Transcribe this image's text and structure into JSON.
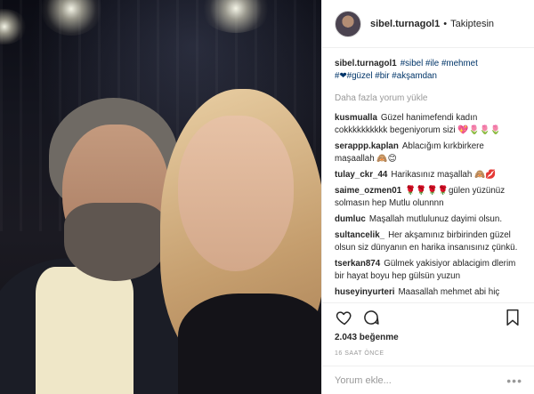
{
  "post": {
    "author": "sibel.turnagol1",
    "separator": "•",
    "follow_status": "Takiptesin",
    "caption": {
      "user": "sibel.turnagol1",
      "text_prefix": "#sibel #ile #mehmet",
      "text_line2": "#❤#güzel #bir #akşamdan"
    },
    "load_more": "Daha fazla yorum yükle",
    "comments": [
      {
        "user": "kusmualla",
        "text": "Güzel hanimefendi kadın cokkkkkkkkkk begeniyorum sizi 💖🌷🌷🌷"
      },
      {
        "user": "serappp.kaplan",
        "text": "Ablacığım kırkbirkere maşaallah 🙈😊"
      },
      {
        "user": "tulay_ckr_44",
        "text": "Harikasınız maşallah 🙈💋"
      },
      {
        "user": "saime_ozmen01",
        "text": "🌹🌹🌹🌹gülen yüzünüz solmasın hep Mutlu olunnnn"
      },
      {
        "user": "dumluc",
        "text": "Maşallah mutlulunuz dayimi olsun."
      },
      {
        "user": "sultancelik_",
        "text": "Her akşamınız birbirinden güzel olsun siz dünyanın en harika insanısınız çünkü."
      },
      {
        "user": "tserkan874",
        "text": "Gülmek yakisiyor ablacigim dlerim bir hayat boyu hep gülsün yuzun"
      },
      {
        "user": "huseyinyurteri",
        "text": "Maasallah mehmet abi hiç"
      }
    ],
    "likes": "2.043 beğenme",
    "time_ago": "16 SAAT ÖNCE",
    "comment_placeholder": "Yorum ekle...",
    "more_glyph": "•••"
  },
  "icons": {
    "like": "heart-icon",
    "comment": "comment-icon",
    "save": "bookmark-icon"
  }
}
